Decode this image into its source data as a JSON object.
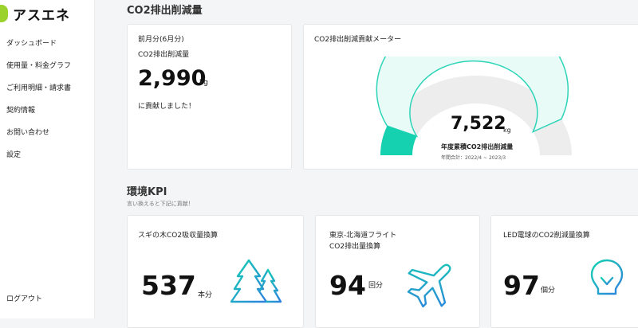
{
  "brand": {
    "logo_text": "アスエネ"
  },
  "sidebar": {
    "items": [
      {
        "label": "ダッシュボード"
      },
      {
        "label": "使用量・料金グラフ"
      },
      {
        "label": "ご利用明細・請求書"
      },
      {
        "label": "契約情報"
      },
      {
        "label": "お問い合わせ"
      },
      {
        "label": "設定"
      }
    ],
    "logout": "ログアウト"
  },
  "co2_section": {
    "title": "CO2排出削減量"
  },
  "monthly": {
    "period": "前月分(6月分)",
    "label": "CO2排出削減量",
    "value": "2,990",
    "unit": "kg",
    "message": "に貢献しました！"
  },
  "meter": {
    "title": "CO2排出削減貢献メーター",
    "value": "7,522",
    "unit": "kg",
    "label": "年度累積CO2排出削減量",
    "range": "年間合計：2022/4 ~ 2023/3",
    "fill_fraction": 0.12,
    "target_fraction": 0.85,
    "colors": {
      "fill": "#16d1b0",
      "target": "#e9fbf7",
      "target_border": "#2dd4b8",
      "remaining": "#ededed"
    }
  },
  "kpi": {
    "title": "環境KPI",
    "subtitle": "言い換えると下記に貢献！",
    "cards": [
      {
        "label_line1": "スギの木CO2吸収量換算",
        "label_line2": "",
        "value": "537",
        "unit": "本分",
        "icon": "trees-icon"
      },
      {
        "label_line1": "東京-北海道フライト",
        "label_line2": "CO2排出量換算",
        "value": "94",
        "unit": "回分",
        "icon": "airplane-icon"
      },
      {
        "label_line1": "LED電球のCO2削減量換算",
        "label_line2": "",
        "value": "97",
        "unit": "個分",
        "icon": "lightbulb-icon"
      }
    ]
  }
}
